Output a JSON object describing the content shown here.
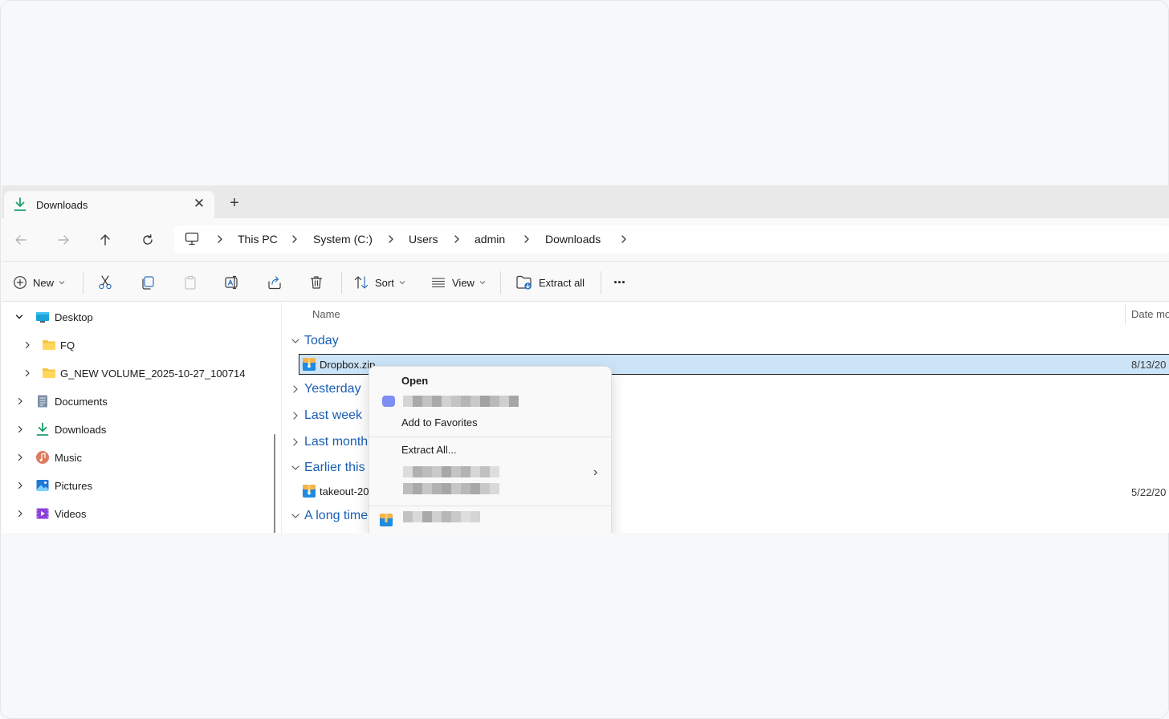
{
  "tab": {
    "title": "Downloads",
    "close_glyph": "✕",
    "new_glyph": "+"
  },
  "nav": {
    "back_icon": "arrow-left-icon",
    "forward_icon": "arrow-right-icon",
    "up_icon": "arrow-up-icon",
    "refresh_icon": "refresh-icon",
    "breadcrumbs": [
      "This PC",
      "System (C:)",
      "Users",
      "admin",
      "Downloads"
    ]
  },
  "toolbar": {
    "new_label": "New",
    "sort_label": "Sort",
    "view_label": "View",
    "extract_label": "Extract all",
    "more_glyph": "···"
  },
  "sidebar": {
    "items": [
      {
        "label": "Desktop",
        "icon": "desktop-icon",
        "expanded": true
      },
      {
        "label": "FQ",
        "icon": "folder-icon"
      },
      {
        "label": "G_NEW VOLUME_2025-10-27_100714",
        "icon": "folder-icon"
      },
      {
        "label": "Documents",
        "icon": "documents-icon"
      },
      {
        "label": "Downloads",
        "icon": "downloads-icon"
      },
      {
        "label": "Music",
        "icon": "music-icon"
      },
      {
        "label": "Pictures",
        "icon": "pictures-icon"
      },
      {
        "label": "Videos",
        "icon": "videos-icon"
      }
    ]
  },
  "content": {
    "col_name": "Name",
    "col_date": "Date mo",
    "groups": {
      "today": "Today",
      "yesterday": "Yesterday",
      "last_week": "Last week",
      "last_month": "Last month",
      "earlier": "Earlier this",
      "long_ago": "A long time"
    },
    "files": {
      "dropbox": {
        "name": "Dropbox.zip",
        "date": "8/13/20"
      },
      "takeout": {
        "name": "takeout-20",
        "date": "5/22/20"
      }
    }
  },
  "context_menu": {
    "open": "Open",
    "favorites": "Add to Favorites",
    "extract": "Extract All...",
    "submenu_glyph": "›"
  },
  "colors": {
    "accent": "#1a5fb4",
    "selection": "#cce4f7",
    "download_green": "#1e9e6a"
  }
}
